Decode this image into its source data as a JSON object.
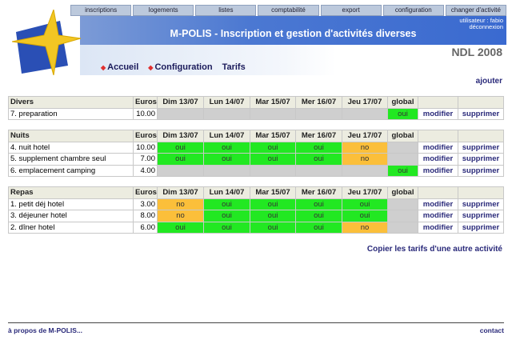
{
  "nav": [
    "inscriptions",
    "logements",
    "listes",
    "comptabilité",
    "export",
    "configuration",
    "changer d'activité"
  ],
  "banner": {
    "title": "M-POLIS - Inscription et gestion d'activités diverses",
    "user": "utilisateur : fabio",
    "logout": "déconnexion"
  },
  "event": "NDL 2008",
  "breadcrumb": [
    "Accueil",
    "Configuration",
    "Tarifs"
  ],
  "add": "ajouter",
  "columns": [
    "Euros",
    "Dim 13/07",
    "Lun 14/07",
    "Mar 15/07",
    "Mer 16/07",
    "Jeu 17/07",
    "global"
  ],
  "actions": {
    "edit": "modifier",
    "delete": "supprimer"
  },
  "sections": [
    {
      "name": "Divers",
      "rows": [
        {
          "label": "7. preparation",
          "euros": "10.00",
          "days": [
            "",
            "",
            "",
            "",
            ""
          ],
          "global": "oui"
        }
      ]
    },
    {
      "name": "Nuits",
      "rows": [
        {
          "label": "4. nuit hotel",
          "euros": "10.00",
          "days": [
            "oui",
            "oui",
            "oui",
            "oui",
            "no"
          ],
          "global": ""
        },
        {
          "label": "5. supplement chambre seul",
          "euros": "7.00",
          "days": [
            "oui",
            "oui",
            "oui",
            "oui",
            "no"
          ],
          "global": ""
        },
        {
          "label": "6. emplacement camping",
          "euros": "4.00",
          "days": [
            "",
            "",
            "",
            "",
            ""
          ],
          "global": "oui"
        }
      ]
    },
    {
      "name": "Repas",
      "rows": [
        {
          "label": "1. petit déj hotel",
          "euros": "3.00",
          "days": [
            "no",
            "oui",
            "oui",
            "oui",
            "oui"
          ],
          "global": ""
        },
        {
          "label": "3. déjeuner hotel",
          "euros": "8.00",
          "days": [
            "no",
            "oui",
            "oui",
            "oui",
            "oui"
          ],
          "global": ""
        },
        {
          "label": "2. dîner hotel",
          "euros": "6.00",
          "days": [
            "oui",
            "oui",
            "oui",
            "oui",
            "no"
          ],
          "global": ""
        }
      ]
    }
  ],
  "copy": "Copier les tarifs d'une autre activité",
  "footer": {
    "about": "à propos de M-POLIS...",
    "contact": "contact"
  }
}
